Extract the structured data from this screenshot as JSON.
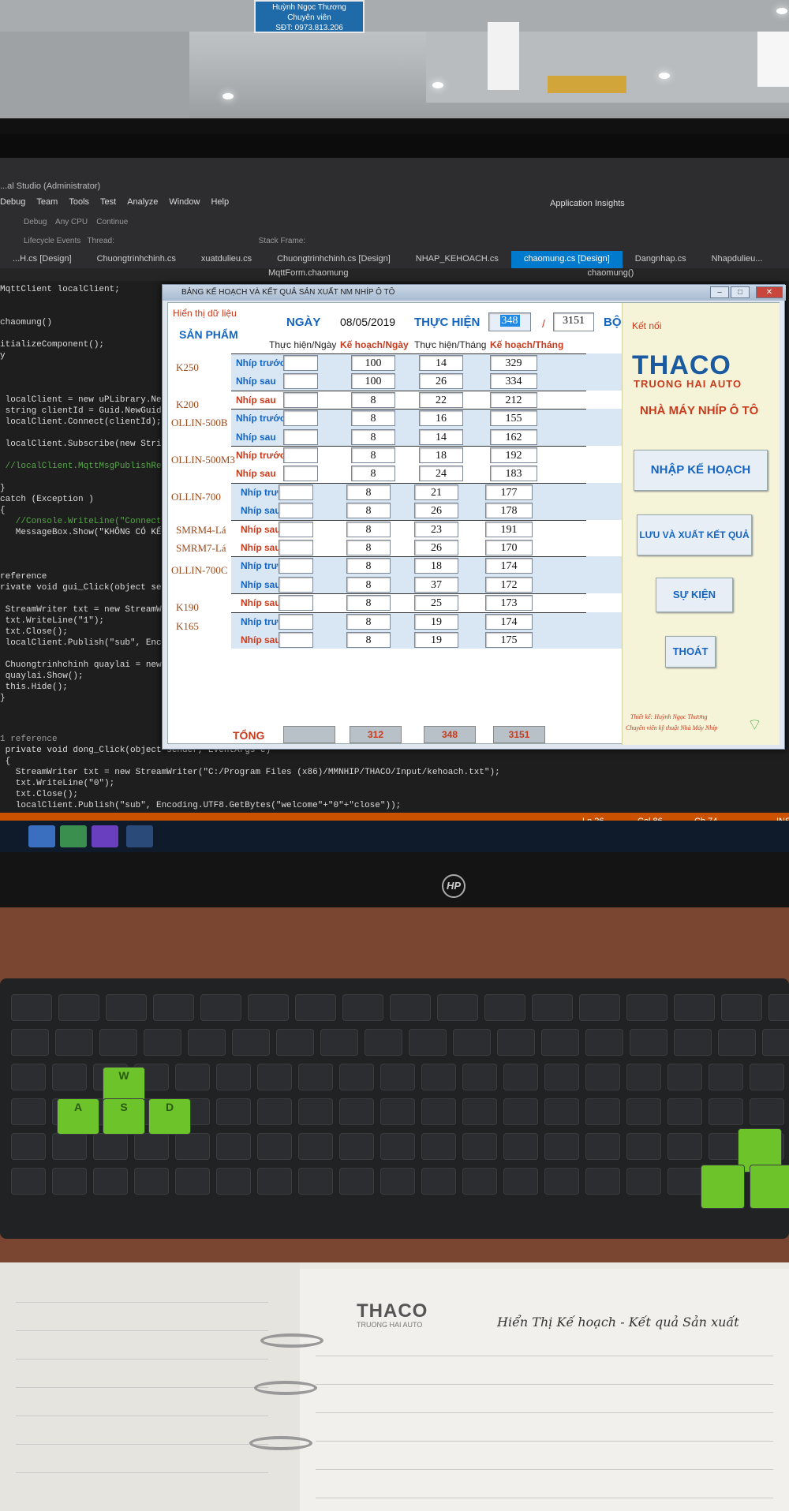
{
  "namecard": {
    "name": "Huỳnh Ngọc Thương",
    "role": "Chuyên viên",
    "phone": "SĐT: 0973.813.206"
  },
  "ide": {
    "title": "...al Studio (Administrator)",
    "menus": [
      "Debug",
      "Team",
      "Tools",
      "Test",
      "Analyze",
      "Window",
      "Help"
    ],
    "config": "Debug",
    "platform": "Any CPU",
    "continue_label": "Continue",
    "app_insights": "Application Insights",
    "lifecycle_events": "Lifecycle Events",
    "thread_label": "Thread:",
    "stack_frame": "Stack Frame:",
    "tabs": [
      "...H.cs [Design]",
      "Chuongtrinhchinh.cs",
      "xuatdulieu.cs",
      "Chuongtrinhchinh.cs [Design]",
      "NHAP_KEHOACH.cs",
      "chaomung.cs [Design]",
      "Dangnhap.cs",
      "Nhapdulieu..."
    ],
    "path_left": "MqttForm.chaomung",
    "path_right": "chaomung()",
    "code_lines": [
      "MqttClient localClient;",
      "",
      "",
      "chaomung()",
      "",
      "itializeComponent();",
      "y",
      "",
      "",
      "",
      " localClient = new uPLibrary.Netw",
      " string clientId = Guid.NewGuid()",
      " localClient.Connect(clientId);",
      "",
      " localClient.Subscribe(new String",
      "",
      " //localClient.MqttMsgPublishRece",
      "",
      "}",
      "catch (Exception )",
      "{",
      "   //Console.WriteLine(\"Connection",
      "   MessageBox.Show(\"KHÔNG CÓ KẾT NỐ",
      "",
      "",
      "",
      "reference",
      "rivate void gui_Click(object sender, Eve",
      "",
      " StreamWriter txt = new StreamWriter(",
      " txt.WriteLine(\"1\");",
      " txt.Close();",
      " localClient.Publish(\"sub\", Encoding.",
      "",
      " Chuongtrinhchinh quaylai = new Chuon",
      " quaylai.Show();",
      " this.Hide();",
      "}"
    ],
    "code_bottom": [
      "1 reference",
      " private void dong_Click(object sender, EventArgs e)",
      " {",
      "   StreamWriter txt = new StreamWriter(\"C:/Program Files (x86)/MMNHIP/THACO/Input/kehoach.txt\");",
      "   txt.WriteLine(\"0\");",
      "   txt.Close();",
      "   localClient.Publish(\"sub\", Encoding.UTF8.GetBytes(\"welcome\"+\"0\"+\"close\"));"
    ],
    "status": {
      "ln": "Ln 26",
      "col": "Col 86",
      "ch": "Ch 74",
      "ins": "INS"
    }
  },
  "app": {
    "window_title": "BẢNG KẾ HOẠCH VÀ KẾT QUẢ SẢN XUẤT NM NHÍP Ô TÔ",
    "display_label": "Hiển thị dữ liệu",
    "product_header": "SẢN PHẨM",
    "date_label": "NGÀY",
    "date_value": "08/05/2019",
    "actual_label": "THỰC HIỆN",
    "actual_value": "348",
    "slash": "/",
    "plan_total_value": "3151",
    "unit": "BỘ",
    "col_actual_day": "Thực hiện/Ngày",
    "col_plan_day": "Kế hoạch/Ngày",
    "col_actual_month": "Thực hiện/Tháng",
    "col_plan_month": "Kế hoạch/Tháng",
    "rows": [
      {
        "product": "K250",
        "spring": "Nhíp trước",
        "actual_day": "",
        "plan_day": "100",
        "actual_month": "14",
        "plan_month": "329"
      },
      {
        "product": "",
        "spring": "Nhíp sau",
        "actual_day": "",
        "plan_day": "100",
        "actual_month": "26",
        "plan_month": "334"
      },
      {
        "product": "K200",
        "spring": "Nhíp sau",
        "actual_day": "",
        "plan_day": "8",
        "actual_month": "22",
        "plan_month": "212"
      },
      {
        "product": "OLLIN-500B",
        "spring": "Nhíp trước",
        "actual_day": "",
        "plan_day": "8",
        "actual_month": "16",
        "plan_month": "155"
      },
      {
        "product": "",
        "spring": "Nhíp sau",
        "actual_day": "",
        "plan_day": "8",
        "actual_month": "14",
        "plan_month": "162"
      },
      {
        "product": "OLLIN-500M3",
        "spring": "Nhíp trước",
        "actual_day": "",
        "plan_day": "8",
        "actual_month": "18",
        "plan_month": "192"
      },
      {
        "product": "",
        "spring": "Nhíp sau",
        "actual_day": "",
        "plan_day": "8",
        "actual_month": "24",
        "plan_month": "183"
      },
      {
        "product": "OLLIN-700",
        "spring": "Nhíp trước",
        "actual_day": "",
        "plan_day": "8",
        "actual_month": "21",
        "plan_month": "177"
      },
      {
        "product": "",
        "spring": "Nhíp sau",
        "actual_day": "",
        "plan_day": "8",
        "actual_month": "26",
        "plan_month": "178"
      },
      {
        "product": "SMRM4-Lá",
        "spring": "Nhíp sau",
        "actual_day": "",
        "plan_day": "8",
        "actual_month": "23",
        "plan_month": "191"
      },
      {
        "product": "SMRM7-Lá",
        "spring": "Nhíp sau",
        "actual_day": "",
        "plan_day": "8",
        "actual_month": "26",
        "plan_month": "170"
      },
      {
        "product": "OLLIN-700C",
        "spring": "Nhíp trước",
        "actual_day": "",
        "plan_day": "8",
        "actual_month": "18",
        "plan_month": "174"
      },
      {
        "product": "",
        "spring": "Nhíp sau",
        "actual_day": "",
        "plan_day": "8",
        "actual_month": "37",
        "plan_month": "172"
      },
      {
        "product": "K190",
        "spring": "Nhíp sau",
        "actual_day": "",
        "plan_day": "8",
        "actual_month": "25",
        "plan_month": "173"
      },
      {
        "product": "K165",
        "spring": "Nhíp trước",
        "actual_day": "",
        "plan_day": "8",
        "actual_month": "19",
        "plan_month": "174"
      },
      {
        "product": "",
        "spring": "Nhíp sau",
        "actual_day": "",
        "plan_day": "8",
        "actual_month": "19",
        "plan_month": "175"
      }
    ],
    "total_label": "TỔNG",
    "total_actual_day": "",
    "total_plan_day": "312",
    "total_actual_month": "348",
    "total_plan_month": "3151",
    "connection_label": "Kết nối",
    "logo_main": "THACO",
    "logo_sub": "TRUONG HAI AUTO",
    "factory_name": "NHÀ MÁY NHÍP Ô TÔ",
    "btn_plan": "NHẬP KẾ HOẠCH",
    "btn_save": "LƯU VÀ XUẤT KẾT QUẢ",
    "btn_event": "SỰ KIỆN",
    "btn_exit": "THOÁT",
    "credit_1": "Thiết kế: Huỳnh Ngọc Thương",
    "credit_2": "Chuyên viên kỹ thuật Nhà Máy Nhíp",
    "colors": {
      "red": "#c83b1d",
      "blue": "#1565c0",
      "band": "#d9e6f4",
      "panel": "#f5f3d8"
    }
  },
  "desk": {
    "brand": "HP",
    "notebook_logo": "THACO",
    "notebook_logo_sub": "TRUONG HAI AUTO",
    "handwriting": "Hiển Thị Kế hoạch - Kết quả Sản xuất",
    "keys_green": [
      "W",
      "A",
      "S",
      "D"
    ]
  }
}
